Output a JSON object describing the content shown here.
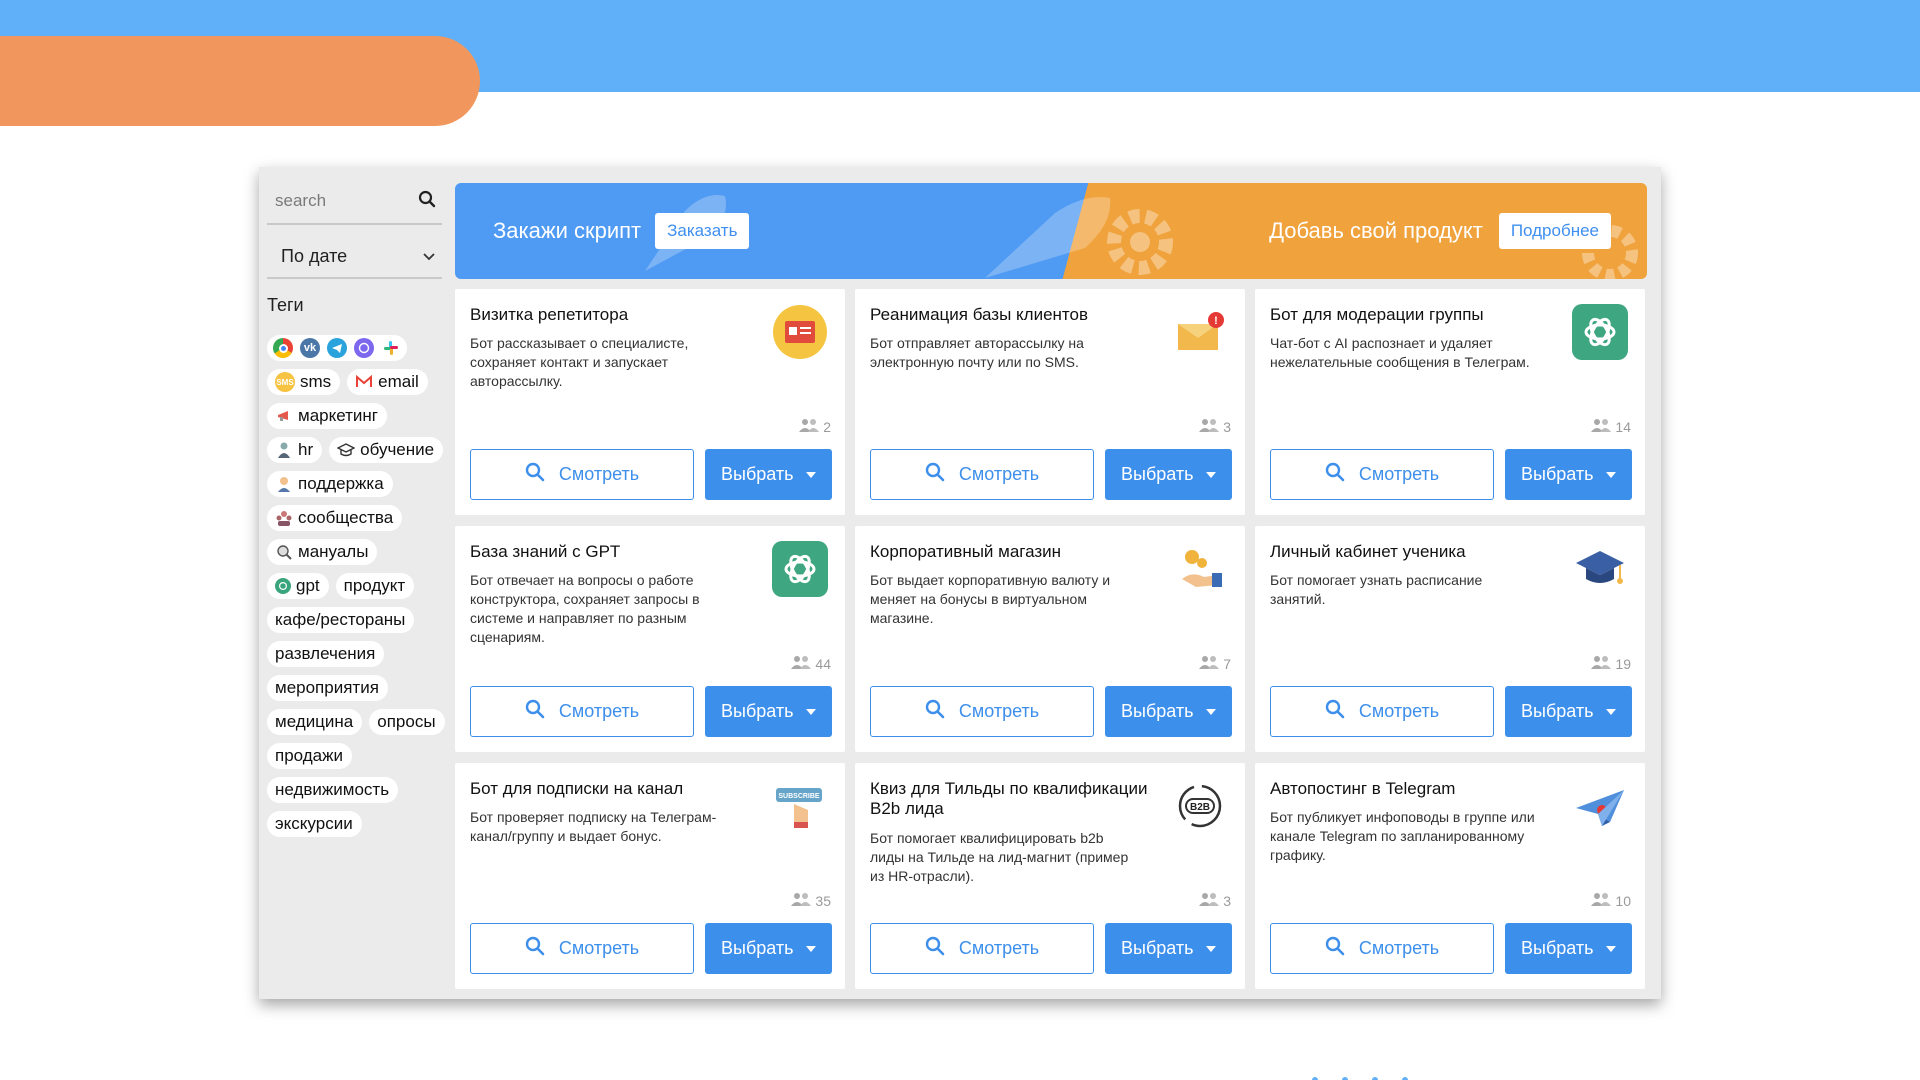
{
  "sidebar": {
    "search_placeholder": "search",
    "sort_value": "По дате",
    "tags_title": "Теги",
    "tags": [
      "sms",
      "email",
      "маркетинг",
      "hr",
      "обучение",
      "поддержка",
      "сообщества",
      "мануалы",
      "gpt",
      "продукт",
      "кафе/рестораны",
      "развлечения",
      "мероприятия",
      "медицина",
      "опросы",
      "продажи",
      "недвижимость",
      "экскурсии"
    ]
  },
  "banner": {
    "left_title": "Закажи скрипт",
    "left_button": "Заказать",
    "right_title": "Добавь свой продукт",
    "right_button": "Подробнее"
  },
  "buttons": {
    "view": "Смотреть",
    "select": "Выбрать"
  },
  "cards": [
    {
      "title": "Визитка репетитора",
      "desc": "Бот рассказывает о специалисте, сохраняет контакт и запускает авторассылку.",
      "users": "2",
      "icon": "business-card-icon"
    },
    {
      "title": "Реанимация базы клиентов",
      "desc": "Бот отправляет авторассылку на электронную почту или по SMS.",
      "users": "3",
      "icon": "mail-notification-icon"
    },
    {
      "title": "Бот для модерации группы",
      "desc": "Чат-бот с AI распознает и удаляет нежелательные сообщения в Телеграм.",
      "users": "14",
      "icon": "openai-icon"
    },
    {
      "title": "База знаний с GPT",
      "desc": "Бот отвечает на вопросы о работе конструктора, сохраняет запросы в системе и направляет по разным сценариям.",
      "users": "44",
      "icon": "openai-icon"
    },
    {
      "title": "Корпоративный магазин",
      "desc": "Бот выдает корпоративную валюту и меняет на бонусы в виртуальном магазине.",
      "users": "7",
      "icon": "coin-hand-icon"
    },
    {
      "title": "Личный кабинет ученика",
      "desc": "Бот помогает узнать расписание занятий.",
      "users": "19",
      "icon": "graduation-cap-icon"
    },
    {
      "title": "Бот для подписки на канал",
      "desc": "Бот проверяет подписку на Телеграм-канал/группу и выдает бонус.",
      "users": "35",
      "icon": "subscribe-icon"
    },
    {
      "title": "Квиз для Тильды по квалификации B2b лида",
      "desc": "Бот помогает квалифицировать b2b лиды на Тильде на лид-магнит (пример из HR-отрасли).",
      "users": "3",
      "icon": "b2b-icon"
    },
    {
      "title": "Автопостинг в Telegram",
      "desc": "Бот публикует инфоповоды в группе или канале Telegram по запланированному графику.",
      "users": "10",
      "icon": "paper-plane-icon"
    }
  ]
}
